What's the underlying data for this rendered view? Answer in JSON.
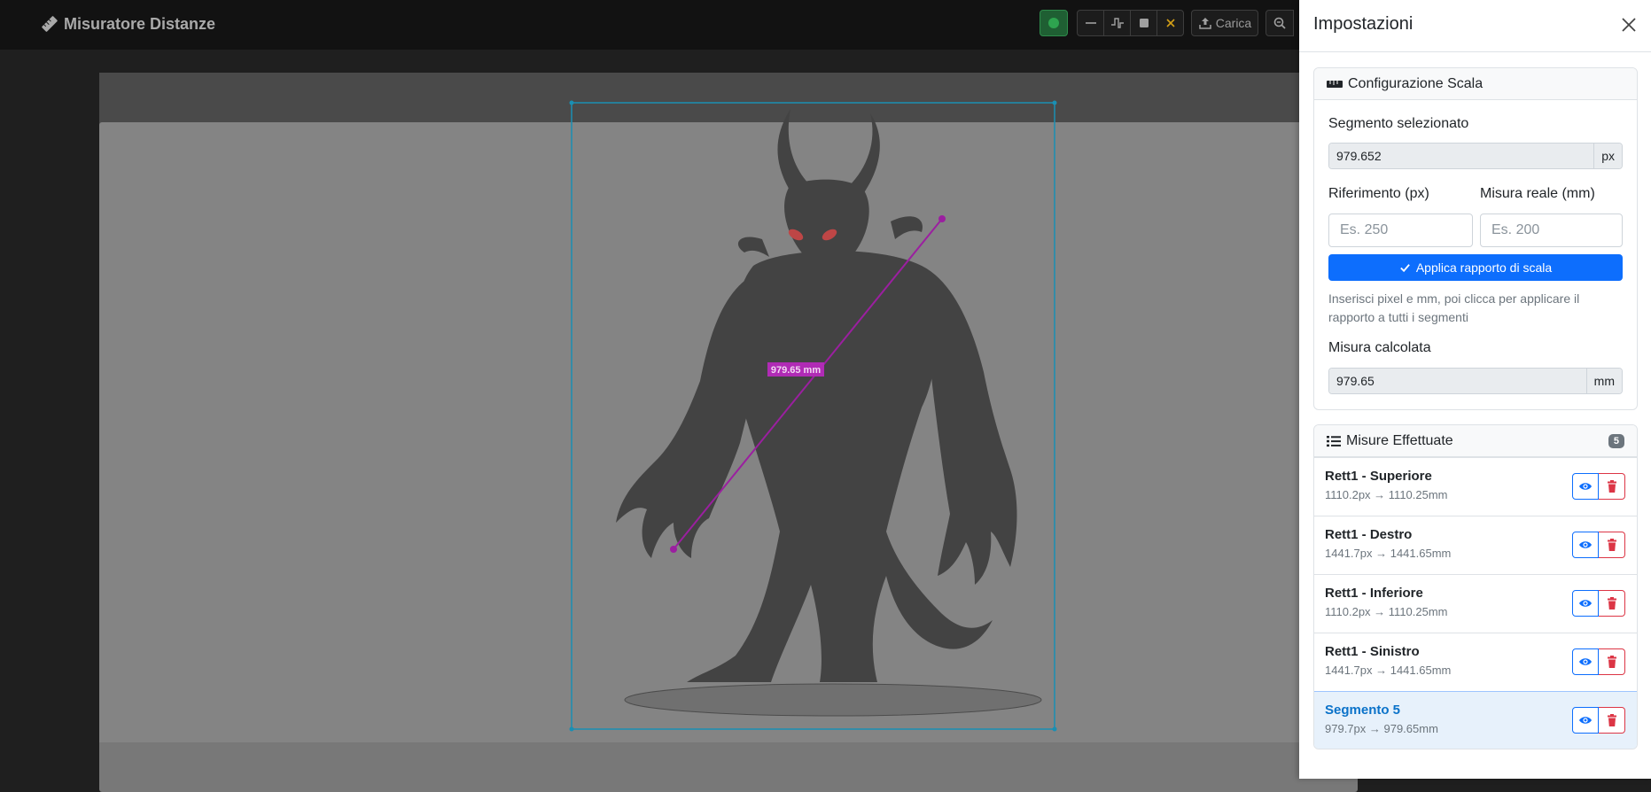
{
  "app": {
    "title": "Misuratore Distanze",
    "icon": "ruler-icon"
  },
  "toolbar": {
    "upload_label": "Carica",
    "tools": [
      "draw-icon",
      "line-icon",
      "polyline-icon",
      "rectangle-icon",
      "clear-icon",
      "upload-icon",
      "zoom-out-icon"
    ]
  },
  "canvas": {
    "measure_label": "979.65 mm"
  },
  "panel": {
    "title": "Impostazioni",
    "scale_card": {
      "title": "Configurazione Scala",
      "selected_label": "Segmento selezionato",
      "selected_value": "979.652",
      "selected_unit": "px",
      "ref_label": "Riferimento (px)",
      "ref_placeholder": "Es. 250",
      "real_label": "Misura reale (mm)",
      "real_placeholder": "Es. 200",
      "apply_label": "Applica rapporto di scala",
      "help_text": "Inserisci pixel e mm, poi clicca per applicare il rapporto a tutti i segmenti",
      "calc_label": "Misura calcolata",
      "calc_value": "979.65",
      "calc_unit": "mm"
    },
    "measures_card": {
      "title": "Misure Effettuate",
      "count": "5",
      "items": [
        {
          "name": "Rett1 - Superiore",
          "meta": "1110.2px → 1110.25mm"
        },
        {
          "name": "Rett1 - Destro",
          "meta": "1441.7px → 1441.65mm"
        },
        {
          "name": "Rett1 - Inferiore",
          "meta": "1110.2px → 1110.25mm"
        },
        {
          "name": "Rett1 - Sinistro",
          "meta": "1441.7px → 1441.65mm"
        },
        {
          "name": "Segmento 5",
          "meta": "979.7px → 979.65mm"
        }
      ]
    }
  },
  "colors": {
    "accent": "#0d6efd",
    "danger": "#dc3545",
    "rect_stroke": "#1a8fb3",
    "segment": "#9b1fa0",
    "active_item_bg": "#e7f1fb"
  }
}
